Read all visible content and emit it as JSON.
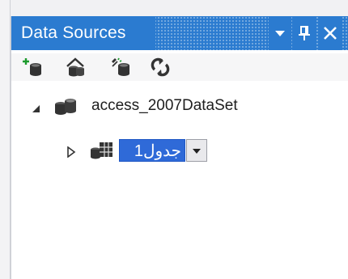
{
  "panel": {
    "title": "Data Sources",
    "accent_color": "#2b7bd0",
    "buttons": [
      {
        "icon": "dropdown-arrow-icon"
      },
      {
        "icon": "pin-icon"
      },
      {
        "icon": "close-icon"
      }
    ]
  },
  "toolbar": {
    "items": [
      {
        "icon": "add-data-source-icon"
      },
      {
        "icon": "edit-dataset-designer-icon"
      },
      {
        "icon": "configure-dataset-icon"
      },
      {
        "icon": "refresh-icon"
      }
    ]
  },
  "tree": {
    "root": {
      "label": "access_2007DataSet",
      "icon": "dataset-icon",
      "expanded": true
    },
    "child": {
      "icon": "table-icon",
      "expanded": false,
      "edit_value": "جدول1",
      "selection_color": "#2f6ad8"
    }
  }
}
